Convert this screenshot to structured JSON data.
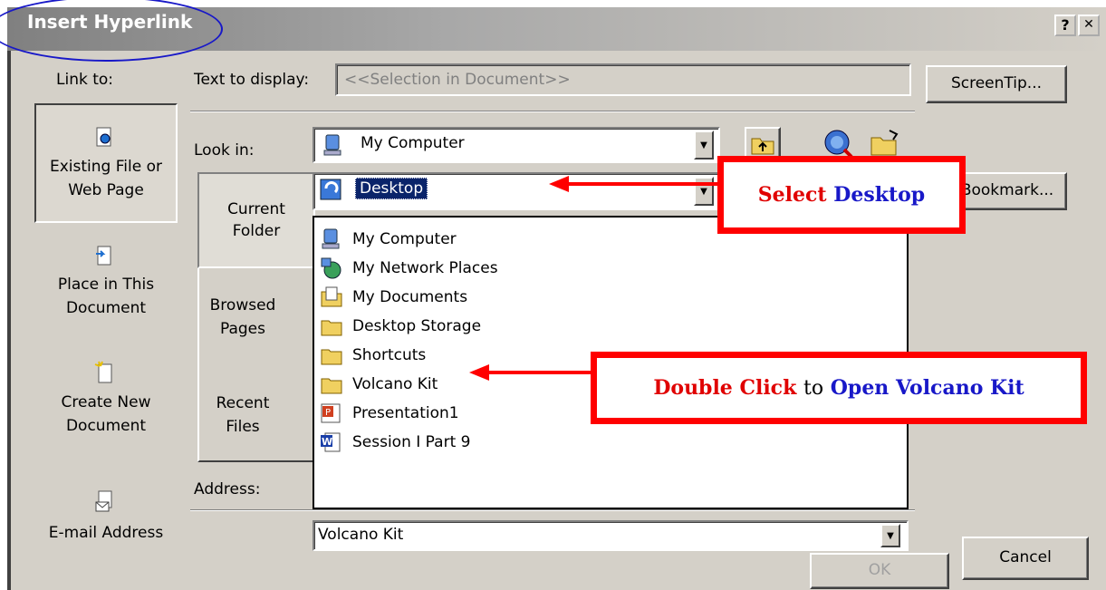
{
  "dialog": {
    "title": "Insert Hyperlink",
    "help_button": "?",
    "close_button": "✕"
  },
  "link_to": {
    "heading": "Link to:",
    "items": [
      {
        "line1": "Existing File or",
        "line2": "Web Page",
        "icon": "file-web-icon"
      },
      {
        "line1": "Place in This",
        "line2": "Document",
        "icon": "place-document-icon"
      },
      {
        "line1": "Create New",
        "line2": "Document",
        "icon": "new-document-icon"
      },
      {
        "line1": "E-mail Address",
        "line2": "",
        "icon": "email-icon"
      }
    ]
  },
  "text_to_display": {
    "label": "Text to display:",
    "value": "<<Selection in Document>>"
  },
  "screentip_button": "ScreenTip...",
  "look_in": {
    "label": "Look in:",
    "value": "My Computer",
    "dropdown_selected": "Desktop"
  },
  "bookmark_button": "Bookmark...",
  "tabs": [
    {
      "line1": "Current",
      "line2": "Folder"
    },
    {
      "line1": "Browsed",
      "line2": "Pages"
    },
    {
      "line1": "Recent",
      "line2": "Files"
    }
  ],
  "dropdown_items": [
    {
      "label": "My Computer",
      "icon": "computer-icon"
    },
    {
      "label": "My Network Places",
      "icon": "network-places-icon"
    },
    {
      "label": "My Documents",
      "icon": "documents-icon"
    },
    {
      "label": "Desktop Storage",
      "icon": "folder-icon"
    },
    {
      "label": "Shortcuts",
      "icon": "folder-icon"
    },
    {
      "label": "Volcano Kit",
      "icon": "folder-icon"
    },
    {
      "label": "Presentation1",
      "icon": "powerpoint-icon"
    },
    {
      "label": "Session I Part 9",
      "icon": "word-icon"
    }
  ],
  "address": {
    "label": "Address:",
    "value": "Volcano Kit"
  },
  "ok_button": "OK",
  "cancel_button": "Cancel",
  "callouts": {
    "select_desktop": {
      "part1": "Select",
      "part2": "Desktop"
    },
    "open_volcano": {
      "part1": "Double Click",
      "part2": "to",
      "part3": "Open Volcano Kit"
    }
  },
  "colors": {
    "callout_border": "#ff0000",
    "callout_red": "#e00000",
    "callout_blue": "#1818c8",
    "selection": "#0a246a",
    "dialog_face": "#d4d0c8"
  }
}
